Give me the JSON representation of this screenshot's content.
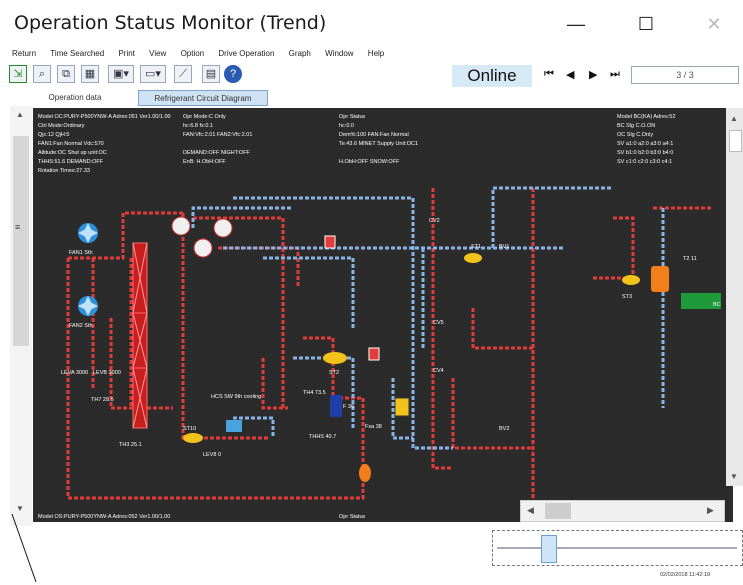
{
  "window": {
    "title": "Operation Status Monitor (Trend)",
    "minimize_glyph": "—",
    "maximize_glyph": "☐",
    "close_glyph": "✕"
  },
  "menu": [
    "Return",
    "Time Searched",
    "Print",
    "View",
    "Option",
    "Drive Operation",
    "Graph",
    "Window",
    "Help"
  ],
  "toolbar": {
    "online_label": "Online",
    "page_indicator": "3 / 3"
  },
  "tabs": [
    {
      "label": "Operation data"
    },
    {
      "label": "Refrigerant Circuit Diagram",
      "active": true
    }
  ],
  "diagram": {
    "header_left": {
      "line1": "Model OC:PURY-P500YNW-A Adres:051 Ver1.00/1.00",
      "line2": "Ctrl Mode:Ordinary",
      "line3": "Qjc:12   QjH:5",
      "line4": "FAN1:Fan Normal  Vdc:570",
      "line5": "Altitude:OC   Shut up unit:OC",
      "line6": "THHS:51.6    DEMAND:OFF",
      "line7": "Rotation Times:27.33"
    },
    "header_mid1": {
      "line1": "Opr Mode:C Only",
      "line2": "hc:6.8     fx:0.1",
      "line3": "FAN:Vfc:2.01   FAN2:Vfc:2.01",
      "line4": "DEMAND:OFF   NIGHT:OFF",
      "line5": "EnB:   H.ObH:OFF"
    },
    "header_mid2": {
      "line1": "Opr Status",
      "line2": "hc:0.0",
      "line3": "Dem%:100   FAN:Fan Normal",
      "line4": "Te:43.6   MINET Supply Unit:OC1",
      "line5": "H.ObH:OFF   SNOW:OFF"
    },
    "header_right": {
      "line1": "Model BC(KA)   Adres:52",
      "line2": "BC Slg C.O.ON",
      "line3": "OC Slg C.Only",
      "line4": "SV a1:0  a2:0  a3:0  a4:1",
      "line5": "SV b1:0  b2:0  b3:0  b4:0",
      "line6": "SV c1:0  c2:0  c3:0  c4:1"
    },
    "labels": {
      "fan1": "FAN1 Sth",
      "fan2": "FAN2 Sth",
      "leva": "LEVA 3000",
      "levb": "LEVB 3000",
      "th7": "TH7 28.5",
      "th3": "TH3 25.1",
      "st10": "ST10",
      "lev8": "LEV8 0",
      "hcs": "HCS SW 9th cooling",
      "st1": "ST1",
      "cv2": "CV2",
      "st2": "ST2",
      "th4": "TH4 73.5",
      "f63": "F 36",
      "th5": "THHS 40.7",
      "fxa": "Fxa 38",
      "cv5": "CV5",
      "cv4": "CV4",
      "bv1": "BV1",
      "bv2": "BV2",
      "st3": "ST3",
      "scc": "SC3 ",
      "lev": "LEV",
      "h": "H",
      "l": "L",
      "te": "T2 11",
      "bc": "BC",
      "footer": "Model OS:PURY-P500YNW-A Adres:052 Ver1.00/1.00",
      "footer_status": "Opr Status"
    }
  },
  "status": {
    "timestamp": "02/02/2018 11:42:19"
  },
  "colors": {
    "canvas": "#2b2b2b",
    "hot_pipe": "#e23b3b",
    "cold_pipe": "#8ab4e6",
    "accent": "#d8e9f6"
  }
}
